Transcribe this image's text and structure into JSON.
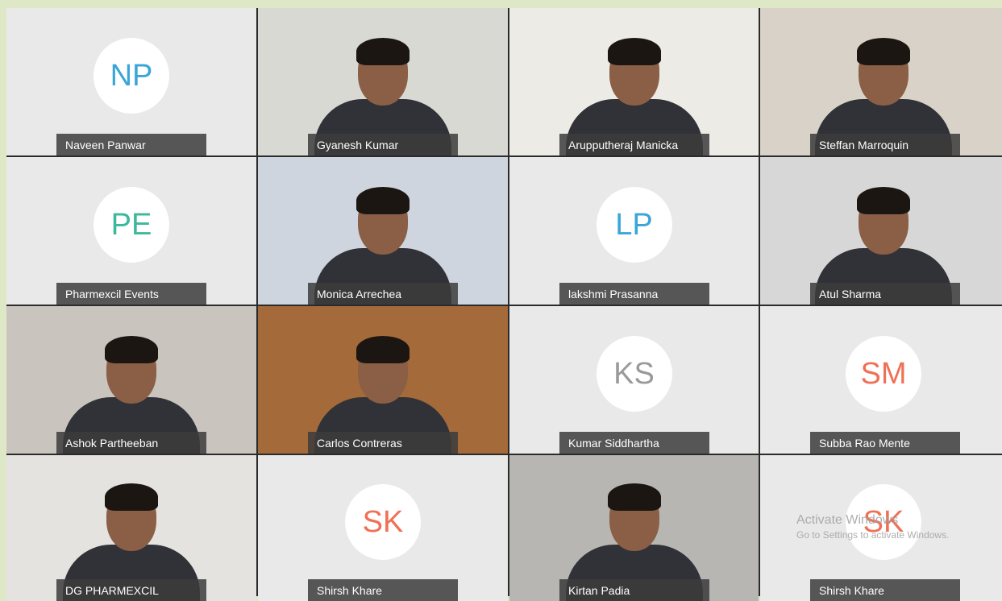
{
  "participants": [
    {
      "name": "Naveen Panwar",
      "initials": "NP",
      "initials_color": "#3aa6d8",
      "video": false
    },
    {
      "name": "Gyanesh Kumar",
      "video": true,
      "bg": "#d9d9d4"
    },
    {
      "name": "Arupputheraj Manicka",
      "video": true,
      "bg": "#ecebe6"
    },
    {
      "name": "Steffan Marroquin",
      "video": true,
      "bg": "#d8d2c8"
    },
    {
      "name": "Pharmexcil Events",
      "initials": "PE",
      "initials_color": "#3cb89a",
      "video": false
    },
    {
      "name": "Monica Arrechea",
      "video": true,
      "bg": "#cfd5de"
    },
    {
      "name": "lakshmi Prasanna",
      "initials": "LP",
      "initials_color": "#3aa6d8",
      "video": false
    },
    {
      "name": "Atul Sharma",
      "video": true,
      "bg": "#d7d7d7"
    },
    {
      "name": "Ashok Partheeban",
      "video": true,
      "bg": "#c9c4be"
    },
    {
      "name": "Carlos Contreras",
      "video": true,
      "bg": "#a46a3a"
    },
    {
      "name": "Kumar Siddhartha",
      "initials": "KS",
      "initials_color": "#9a9a9a",
      "video": false
    },
    {
      "name": "Subba Rao Mente",
      "initials": "SM",
      "initials_color": "#f07055",
      "video": false
    },
    {
      "name": "DG PHARMEXCIL",
      "video": true,
      "bg": "#e4e3e0"
    },
    {
      "name": "Shirsh Khare",
      "initials": "SK",
      "initials_color": "#f07055",
      "video": false
    },
    {
      "name": "Kirtan Padia",
      "video": true,
      "bg": "#b8b6b3"
    },
    {
      "name": "Shirsh Khare",
      "initials": "SK",
      "initials_color": "#f07055",
      "video": false
    }
  ],
  "watermark": {
    "title": "Activate Windows",
    "subtitle": "Go to Settings to activate Windows."
  }
}
